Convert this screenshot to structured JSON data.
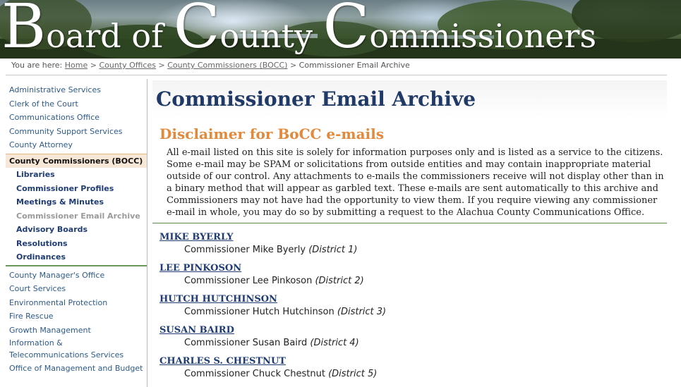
{
  "banner": {
    "cap1": "B",
    "rest1": "oard of ",
    "cap2": "C",
    "rest2": "ounty ",
    "cap3": "C",
    "rest3": "ommissioners"
  },
  "breadcrumb": {
    "prefix": "You are here:",
    "links": [
      "Home",
      "County Offices",
      "County Commissioners (BOCC)"
    ],
    "separator": ">",
    "current": "Commissioner Email Archive"
  },
  "sidebar": {
    "items_top": [
      "Administrative Services",
      "Clerk of the Court",
      "Communications Office",
      "Community Support Services",
      "County Attorney"
    ],
    "active": "County Commissioners (BOCC)",
    "sub_items": [
      "Libraries",
      "Commissioner Profiles",
      "Meetings & Minutes",
      "Commissioner Email Archive",
      "Advisory Boards",
      "Resolutions",
      "Ordinances"
    ],
    "items_bottom": [
      "County Manager's Office",
      "Court Services",
      "Environmental Protection",
      "Fire Rescue",
      "Growth Management",
      "Information & Telecommunications Services",
      "Office of Management and Budget"
    ]
  },
  "main": {
    "title": "Commissioner Email Archive",
    "disclaimer_title": "Disclaimer for BoCC e-mails",
    "disclaimer_text": "All e-mail listed on this site is solely for information purposes only and is listed as a service to the citizens. Some e-mail may be SPAM or solicitations from outside entities and may contain inappropriate material outside of our control. Any attachments to e-mails the commissioners receive will not display other than in a binary method that will appear as garbled text. These e-mails are sent automatically to this archive and Commissioners may not have had the opportunity to view them. If you require viewing any commissioner e-mail in whole, you may do so by submitting a request to the Alachua County Communications Office.",
    "commissioners": [
      {
        "name": "MIKE BYERLY",
        "desc": "Commissioner Mike Byerly",
        "district": "(District 1)"
      },
      {
        "name": "LEE PINKOSON",
        "desc": "Commissioner Lee Pinkoson",
        "district": "(District 2)"
      },
      {
        "name": "HUTCH HUTCHINSON",
        "desc": "Commissioner Hutch Hutchinson",
        "district": "(District 3)"
      },
      {
        "name": "SUSAN BAIRD",
        "desc": "Commissioner Susan Baird",
        "district": "(District 4)"
      },
      {
        "name": "CHARLES S. CHESTNUT",
        "desc": "Commissioner Chuck Chestnut",
        "district": "(District 5)"
      }
    ]
  }
}
